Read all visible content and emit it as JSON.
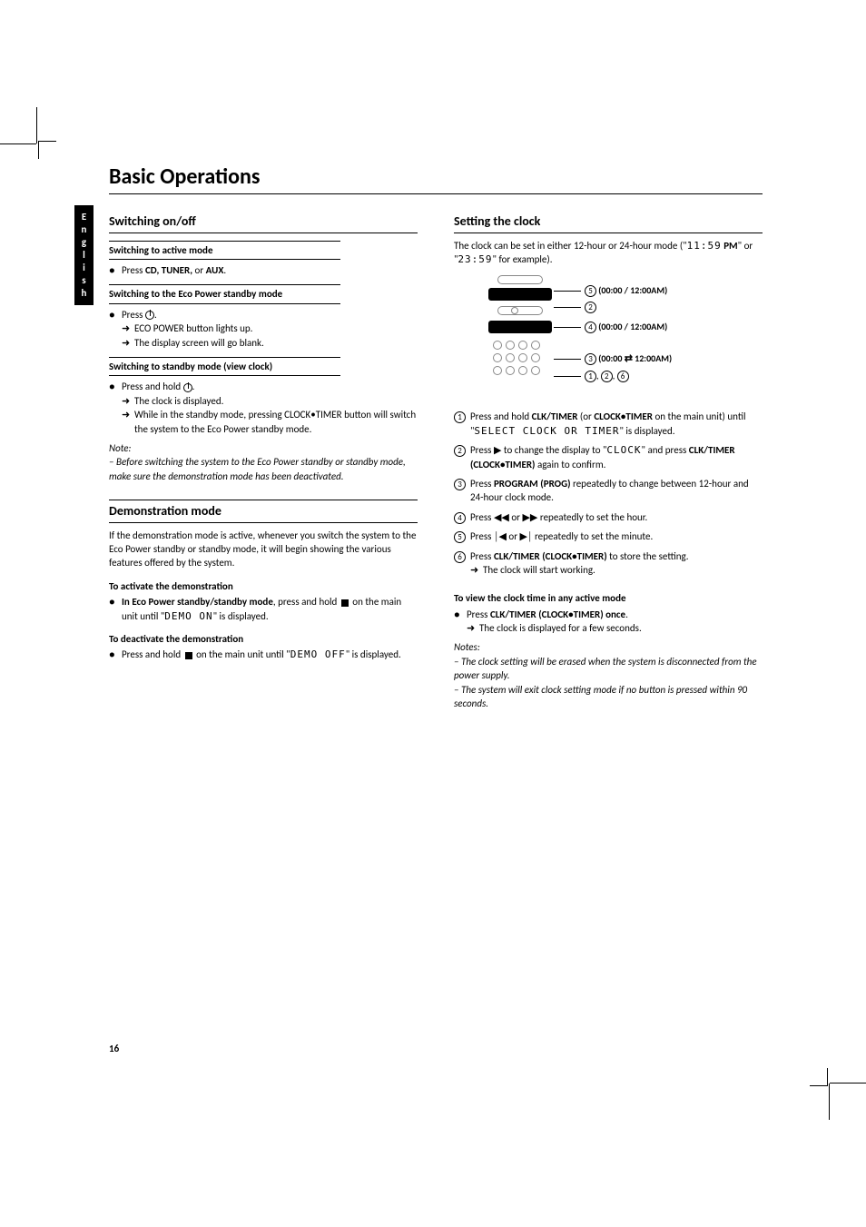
{
  "lang_tab": "English",
  "title": "Basic Operations",
  "page_number": "16",
  "left": {
    "h_on_off": "Switching on/off",
    "h_active": "Switching to active mode",
    "press_cd_tuner_aux_pre": "Press",
    "press_cd_tuner_aux_strong": " CD, TUNER,",
    "press_cd_tuner_aux_post": " or ",
    "press_cd_tuner_aux_aux": "AUX",
    "h_eco": "Switching to the Eco Power standby mode",
    "press_power": "Press ",
    "eco_lights": "ECO POWER button lights up.",
    "screen_blank": "The display screen will go blank.",
    "h_standby": "Switching to standby mode (view clock)",
    "press_hold_power": "Press and hold ",
    "clock_displayed": "The clock is displayed.",
    "while_standby": "While in the standby mode, pressing CLOCK•TIMER button will switch the system to the Eco Power standby mode.",
    "note_label": "Note:",
    "note_body": "– Before switching the system to the Eco Power standby or standby mode, make sure the demonstration mode has been deactivated.",
    "h_demo": "Demonstration mode",
    "demo_intro": "If the demonstration mode is active, whenever you switch the system to the Eco Power standby or standby mode, it will begin showing the various features offered by the system.",
    "h_activate": "To activate the demonstration",
    "activate_1": "In Eco Power standby/standby mode",
    "activate_2": ", press and hold ",
    "activate_3": " on the main unit until \"",
    "demo_on": "DEMO ON",
    "activate_4": "\" is displayed.",
    "h_deactivate": "To deactivate the demonstration",
    "deactivate_1": "Press and hold ",
    "deactivate_2": " on the main unit until \"",
    "demo_off": "DEMO OFF",
    "deactivate_3": "\" is displayed."
  },
  "right": {
    "h_clock": "Setting the clock",
    "clock_intro_1": "The clock can be set in either 12-hour or 24-hour mode (\"",
    "eleven59": "11:59",
    "pm": "PM",
    "clock_intro_2": "\" or \"",
    "t2359": "23:59",
    "clock_intro_3": "\" for example).",
    "cl5": "(00:00 / 12:00AM)",
    "cl4": "(00:00 / 12:00AM)",
    "cl3": "(00:00 ",
    "cl3b": " 12:00AM)",
    "cl126_1": "1",
    "cl126_2": "2",
    "cl126_3": "6",
    "step1_a": "Press and hold ",
    "step1_b": "CLK/TIMER",
    "step1_c": " (or ",
    "step1_d": "CLOCK•TIMER",
    "step1_e": " on the main unit) until \"",
    "select_clock": "SELECT CLOCK OR TIMER",
    "step1_f": "\" is displayed.",
    "step2_a": "Press ",
    "step2_b": " to change the display to \"",
    "clock_txt": "CLOCK",
    "step2_c": "\" and press ",
    "step2_d": "CLK/TIMER (CLOCK•TIMER)",
    "step2_e": " again to confirm.",
    "step3_a": "Press ",
    "step3_b": "PROGRAM (PROG)",
    "step3_c": " repeatedly to change between 12-hour and 24-hour clock mode.",
    "step4_a": "Press ",
    "step4_b": " or ",
    "step4_c": " repeatedly to set the hour.",
    "step5_a": "Press ",
    "step5_b": " or ",
    "step5_c": " repeatedly to set the minute.",
    "step6_a": "Press ",
    "step6_b": "CLK/TIMER (CLOCK•TIMER)",
    "step6_c": " to store the setting.",
    "step6_arrow": "The clock will start working.",
    "h_view": "To view the clock time in any active mode",
    "view_a": "Press ",
    "view_b": "CLK/TIMER (CLOCK•TIMER) once",
    "view_arrow": "The clock is displayed for a few seconds.",
    "notes_label": "Notes:",
    "note1": "– The clock setting will be erased when the system is disconnected from the power supply.",
    "note2": "– The system will exit clock setting mode if no button is pressed within 90 seconds."
  }
}
